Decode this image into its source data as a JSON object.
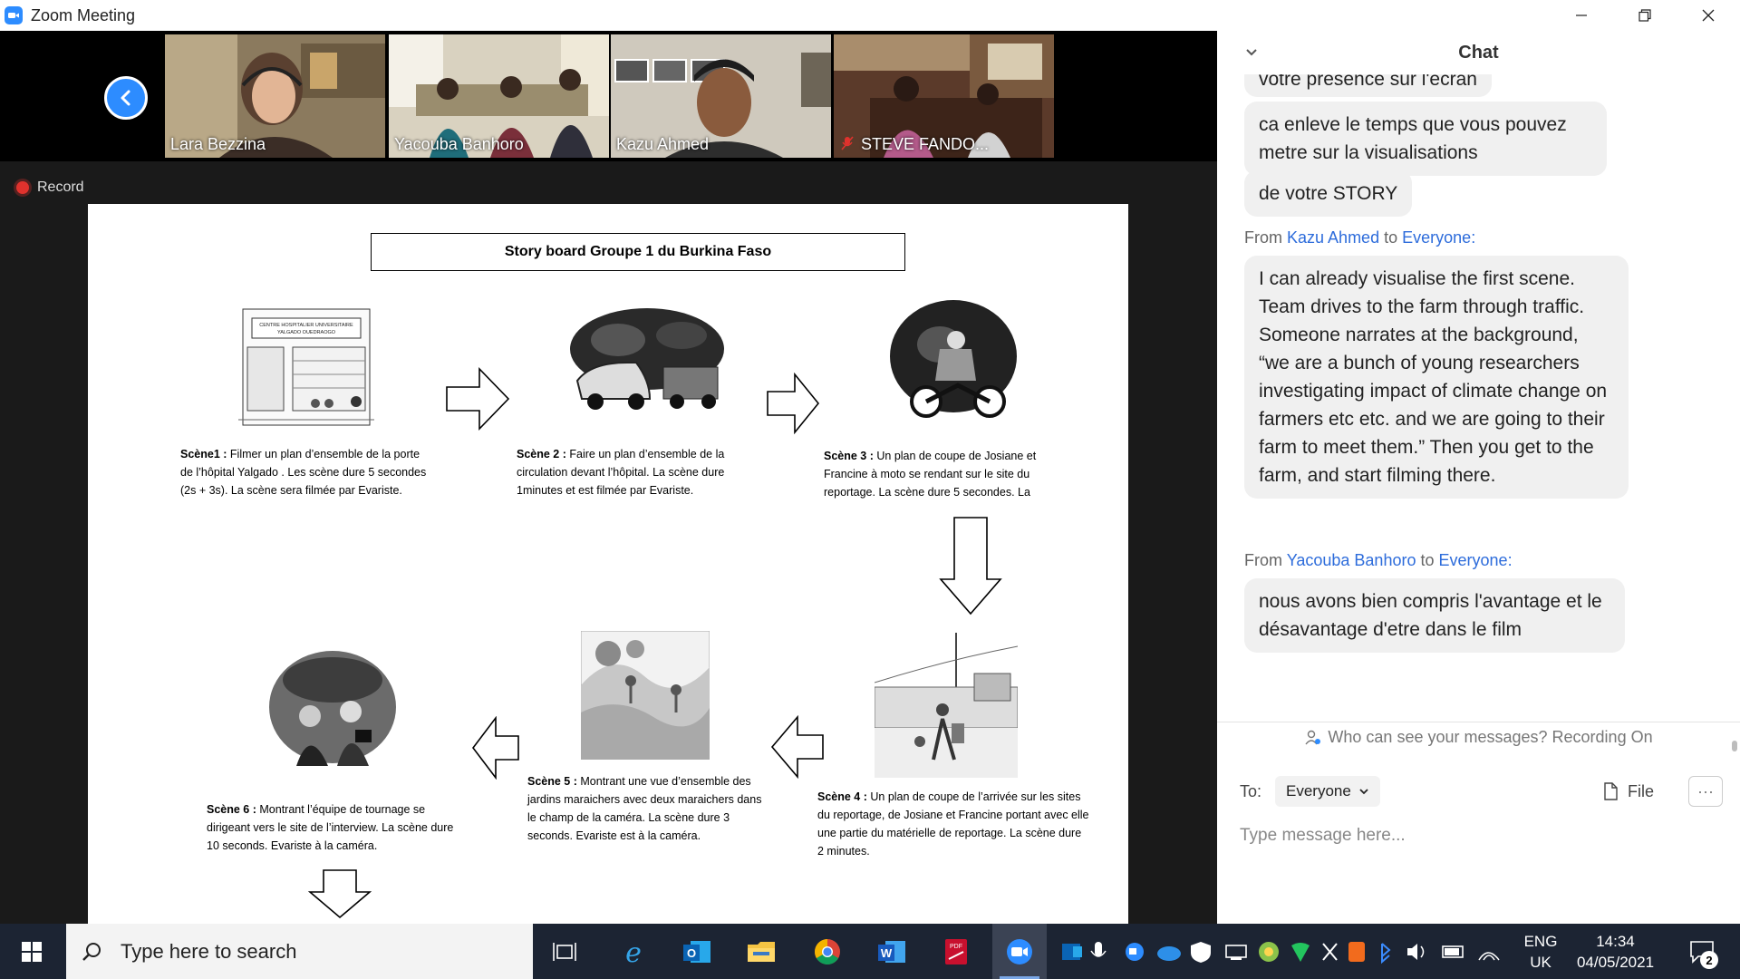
{
  "window": {
    "title": "Zoom Meeting"
  },
  "participants": [
    {
      "name": "Lara Bezzina",
      "active": true,
      "muted": false
    },
    {
      "name": "Yacouba Banhoro",
      "active": false,
      "muted": false
    },
    {
      "name": "Kazu Ahmed",
      "active": false,
      "muted": false
    },
    {
      "name": "STEVE FANDO...",
      "active": false,
      "muted": true
    }
  ],
  "recording": {
    "label": "Record"
  },
  "slide": {
    "title": "Story board Groupe 1 du Burkina Faso",
    "scenes": [
      {
        "label": "Scène1 :",
        "text": "Filmer un plan d’ensemble de la porte de l’hôpital Yalgado . Les scène dure 5 secondes (2s + 3s). La scène sera filmée par Evariste."
      },
      {
        "label": "Scène 2 :",
        "text": "Faire un plan d’ensemble de la circulation devant l’hôpital. La scène dure 1minutes et est filmée par Evariste."
      },
      {
        "label": "Scène 3 :",
        "text": "Un plan de coupe de Josiane et Francine à moto se rendant sur le site du reportage. La scène dure 5 secondes. La"
      },
      {
        "label": "Scène 4 :",
        "text": "Un plan de coupe de l’arrivée sur les sites du reportage, de Josiane et Francine portant avec elle une partie du matérielle de reportage. La scène dure 2 minutes."
      },
      {
        "label": "Scène 5 :",
        "text": "Montrant une vue d’ensemble des jardins maraichers avec deux maraichers dans le champ de la caméra. La scène dure 3 seconds. Evariste est à la caméra."
      },
      {
        "label": "Scène 6 :",
        "text": "Montrant l’équipe de tournage se dirigeant vers le site de l’interview. La scène dure 10 seconds. Evariste à la caméra."
      }
    ],
    "hospital_sign": "CENTRE HOSPITALIER UNIVERSITAIRE YALGADO OUEDRAOGO"
  },
  "chat": {
    "title": "Chat",
    "messages_top": [
      "votre presence sur l'ecran",
      "ca enleve le temps que vous pouvez metre sur la visualisations",
      "de votre STORY"
    ],
    "groups": [
      {
        "from_prefix": "From",
        "sender": "Kazu Ahmed",
        "to_word": "to",
        "recipient": "Everyone",
        "suffix": ":",
        "text": "I can already visualise the first scene. Team drives to the farm through traffic. Someone narrates at the background, “we are a bunch of young researchers investigating impact of climate change on farmers etc etc. and we are going to their farm to meet them.” Then you get to the farm, and start filming there."
      },
      {
        "from_prefix": "From",
        "sender": "Yacouba Banhoro",
        "to_word": "to",
        "recipient": "Everyone",
        "suffix": ":",
        "text": "nous avons bien compris l'avantage et le désavantage d'etre dans le film"
      }
    ],
    "privacy": "Who can see your messages? Recording On",
    "to_label": "To:",
    "to_value": "Everyone",
    "file_label": "File",
    "more_label": "···",
    "input_placeholder": "Type message here..."
  },
  "taskbar": {
    "search_placeholder": "Type here to search",
    "language_line1": "ENG",
    "language_line2": "UK",
    "time": "14:34",
    "date": "04/05/2021",
    "notifications": "2"
  }
}
